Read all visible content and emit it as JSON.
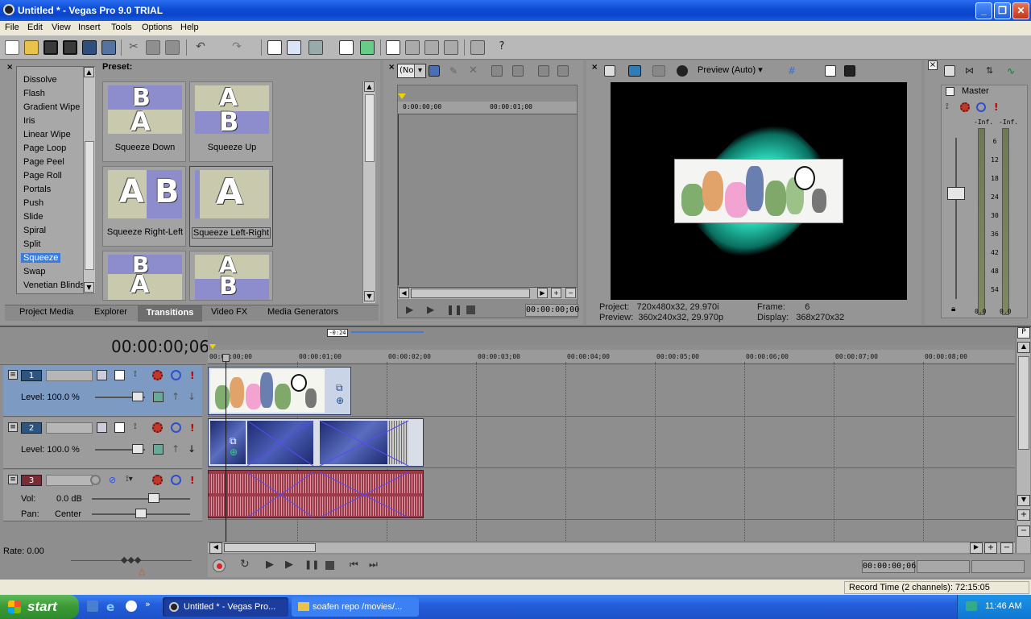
{
  "window": {
    "title": "Untitled * - Vegas Pro 9.0 TRIAL"
  },
  "menu": [
    "File",
    "Edit",
    "View",
    "Insert",
    "Tools",
    "Options",
    "Help"
  ],
  "transitions": {
    "list": [
      "Dissolve",
      "Flash",
      "Gradient Wipe",
      "Iris",
      "Linear Wipe",
      "Page Loop",
      "Page Peel",
      "Page Roll",
      "Portals",
      "Push",
      "Slide",
      "Spiral",
      "Split",
      "Squeeze",
      "Swap",
      "Venetian Blinds"
    ],
    "selected": "Squeeze",
    "preset_label": "Preset:",
    "presets": [
      "Squeeze Down",
      "Squeeze Up",
      "Squeeze Right-Left",
      "Squeeze Left-Right"
    ]
  },
  "tabs": [
    "Project Media",
    "Explorer",
    "Transitions",
    "Video FX",
    "Media Generators"
  ],
  "active_tab": "Transitions",
  "trimmer": {
    "dropdown": "(No",
    "ruler_start": "0:00:00;00",
    "ruler_mid": "00:00:01;00",
    "time": "00:00:00;00"
  },
  "preview": {
    "mode": "Preview (Auto)",
    "project_label": "Project:",
    "project_value": "720x480x32, 29.970i",
    "preview_label": "Preview:",
    "preview_value": "360x240x32, 29.970p",
    "frame_label": "Frame:",
    "frame_value": "6",
    "display_label": "Display:",
    "display_value": "368x270x32"
  },
  "master": {
    "title": "Master",
    "left_peak": "-Inf.",
    "right_peak": "-Inf.",
    "scale": [
      "6",
      "12",
      "18",
      "24",
      "30",
      "36",
      "42",
      "48",
      "54"
    ],
    "left_level": "0.0",
    "right_level": "0.0"
  },
  "timeline": {
    "current_time": "00:00:00;06",
    "marker": "-0:24",
    "ruler": [
      "00:00:00;00",
      "00:00:01;00",
      "00:00:02;00",
      "00:00:03;00",
      "00:00:04;00",
      "00:00:05;00",
      "00:00:06;00",
      "00:00:07;00",
      "00:00:08;00"
    ],
    "tracks": [
      {
        "num": "1",
        "level": "Level: 100.0 %"
      },
      {
        "num": "2",
        "level": "Level: 100.0 %"
      },
      {
        "num": "3",
        "vol_label": "Vol:",
        "vol": "0.0 dB",
        "pan_label": "Pan:",
        "pan": "Center"
      }
    ],
    "rate": "Rate: 0.00",
    "transport_time": "00:00:00;06",
    "record_time": "Record Time (2 channels): 72:15:05"
  },
  "taskbar": {
    "start": "start",
    "items": [
      "Untitled * - Vegas Pro...",
      "soafen repo /movies/..."
    ],
    "clock": "11:46 AM"
  },
  "colors": {
    "selection": "#3b7bde",
    "preview_glow": "#2de0c0",
    "audio_clip": "#9c3a4a",
    "video_clip": "#2c3c8c"
  }
}
